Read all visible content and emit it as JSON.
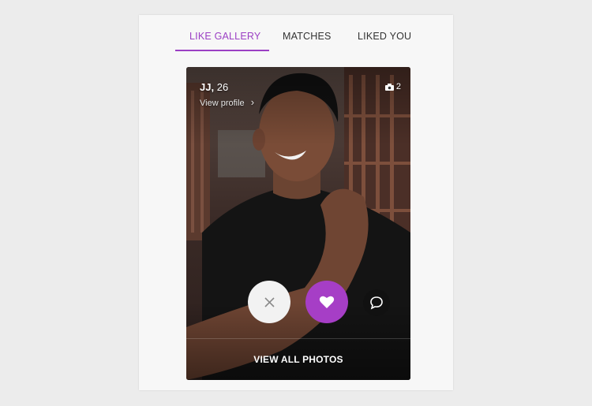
{
  "tabs": [
    {
      "label": "LIKE GALLERY",
      "active": true
    },
    {
      "label": "MATCHES",
      "active": false
    },
    {
      "label": "LIKED YOU",
      "active": false
    }
  ],
  "profile": {
    "name": "JJ",
    "age": "26",
    "view_profile_label": "View profile",
    "photo_count": "2"
  },
  "actions": {
    "dislike_icon": "close-icon",
    "like_icon": "heart-icon",
    "message_icon": "chat-bubble-icon",
    "view_all_label": "VIEW ALL PHOTOS"
  },
  "colors": {
    "accent": "#9b3fc4",
    "like_button": "#a63ec6",
    "dislike_button": "#f2f2f2"
  }
}
